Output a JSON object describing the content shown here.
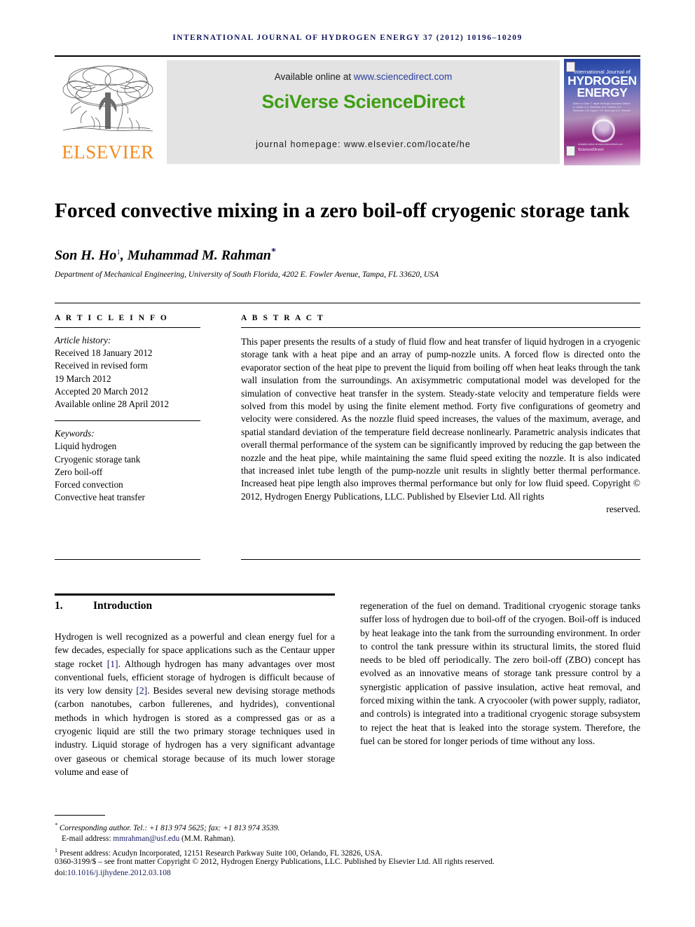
{
  "running_head": "International Journal of Hydrogen Energy 37 (2012) 10196–10209",
  "masthead": {
    "publisher_name": "ELSEVIER",
    "publisher_logo": "elsevier-tree-logo",
    "available_prefix": "Available online at ",
    "available_url": "www.sciencedirect.com",
    "wordmark": "SciVerse ScienceDirect",
    "homepage_line": "journal homepage: www.elsevier.com/locate/he",
    "cover": {
      "line_small": "International Journal of",
      "line_big_1": "HYDROGEN",
      "line_big_2": "ENERGY",
      "editors": "Editor-in-Chief:  T. Nejat Veziroglu\nAssociate Editors:  A. Hurkic, E.C. Bromhan, M.A. Karolis,\nm.C. Momirlan, J.M. Ogden,\nT.N. Sasri and S.A. Sherwin",
      "footer_brand": "ScienceDirect",
      "footer_note": "Available online at www.sciencedirect.com"
    }
  },
  "article": {
    "title": "Forced convective mixing in a zero boil-off cryogenic storage tank",
    "authors_prefix": "Son H. Ho",
    "author1_mark": "1",
    "authors_suffix": ", Muhammad M. Rahman",
    "author2_mark": "*",
    "affiliation": "Department of Mechanical Engineering, University of South Florida, 4202 E. Fowler Avenue, Tampa, FL 33620, USA"
  },
  "info": {
    "heading": "A R T I C L E   I N F O",
    "history_label": "Article history:",
    "history": [
      "Received 18 January 2012",
      "Received in revised form",
      "19 March 2012",
      "Accepted 20 March 2012",
      "Available online 28 April 2012"
    ],
    "keywords_label": "Keywords:",
    "keywords": [
      "Liquid hydrogen",
      "Cryogenic storage tank",
      "Zero boil-off",
      "Forced convection",
      "Convective heat transfer"
    ]
  },
  "abstract": {
    "heading": "A B S T R A C T",
    "body": "This paper presents the results of a study of fluid flow and heat transfer of liquid hydrogen in a cryogenic storage tank with a heat pipe and an array of pump-nozzle units. A forced flow is directed onto the evaporator section of the heat pipe to prevent the liquid from boiling off when heat leaks through the tank wall insulation from the surroundings. An axisymmetric computational model was developed for the simulation of convective heat transfer in the system. Steady-state velocity and temperature fields were solved from this model by using the finite element method. Forty five configurations of geometry and velocity were considered. As the nozzle fluid speed increases, the values of the maximum, average, and spatial standard deviation of the temperature field decrease nonlinearly. Parametric analysis indicates that overall thermal performance of the system can be significantly improved by reducing the gap between the nozzle and the heat pipe, while maintaining the same fluid speed exiting the nozzle. It is also indicated that increased inlet tube length of the pump-nozzle unit results in slightly better thermal performance. Increased heat pipe length also improves thermal performance but only for low fluid speed. Copyright © 2012, Hydrogen Energy Publications, LLC. Published by Elsevier Ltd. All rights",
    "body_last_line": "reserved."
  },
  "section1": {
    "number": "1.",
    "title": "Introduction",
    "left_part1": "Hydrogen is well recognized as a powerful and clean energy fuel for a few decades, especially for space applications such as the Centaur upper stage rocket ",
    "ref1": "[1]",
    "left_part2": ". Although hydrogen has many advantages over most conventional fuels, efficient storage of hydrogen is difficult because of its very low density ",
    "ref2": "[2]",
    "left_part3": ". Besides several new devising storage methods (carbon nanotubes, carbon fullerenes, and hydrides), conventional methods in which hydrogen is stored as a compressed gas or as a cryogenic liquid are still the two primary storage techniques used in industry. Liquid storage of hydrogen has a very significant advantage over gaseous or chemical storage because of its much lower storage volume and ease of",
    "right": "regeneration of the fuel on demand. Traditional cryogenic storage tanks suffer loss of hydrogen due to boil-off of the cryogen. Boil-off is induced by heat leakage into the tank from the surrounding environment. In order to control the tank pressure within its structural limits, the stored fluid needs to be bled off periodically. The zero boil-off (ZBO) concept has evolved as an innovative means of storage tank pressure control by a synergistic application of passive insulation, active heat removal, and forced mixing within the tank. A cryocooler (with power supply, radiator, and controls) is integrated into a traditional cryogenic storage subsystem to reject the heat that is leaked into the storage system. Therefore, the fuel can be stored for longer periods of time without any loss."
  },
  "footnotes": {
    "corresponding": "Corresponding author. Tel.: +1 813 974 5625; fax: +1 813 974 3539.",
    "corresponding_mark": "*",
    "email_label": "E-mail address: ",
    "email": "mmrahman@usf.edu",
    "email_suffix": " (M.M. Rahman).",
    "present_mark": "1",
    "present_address": "Present address: Acudyn Incorporated, 12151 Research Parkway Suite 100, Orlando, FL 32826, USA."
  },
  "imprint": {
    "line1": "0360-3199/$ – see front matter Copyright © 2012, Hydrogen Energy Publications, LLC. Published by Elsevier Ltd. All rights reserved.",
    "doi_label": "doi:",
    "doi": "10.1016/j.ijhydene.2012.03.108"
  },
  "colors": {
    "link": "#13195e",
    "sciencedirect_green": "#3d9e13",
    "elsevier_orange": "#f08c22",
    "banner_grey": "#e3e3e3"
  }
}
